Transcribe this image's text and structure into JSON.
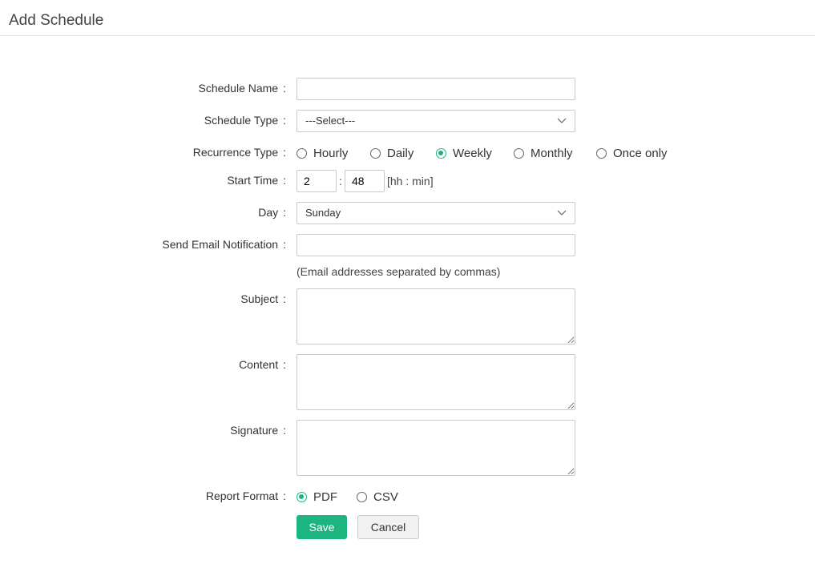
{
  "page": {
    "title": "Add Schedule"
  },
  "form": {
    "schedule_name": {
      "label": "Schedule Name",
      "value": ""
    },
    "schedule_type": {
      "label": "Schedule Type",
      "value": "---Select---"
    },
    "recurrence_type": {
      "label": "Recurrence Type",
      "options": [
        "Hourly",
        "Daily",
        "Weekly",
        "Monthly",
        "Once only"
      ],
      "selected": "Weekly"
    },
    "start_time": {
      "label": "Start Time",
      "hours": "2",
      "minutes": "48",
      "separator": ":",
      "hint": "[hh : min]"
    },
    "day": {
      "label": "Day",
      "value": "Sunday"
    },
    "email": {
      "label": "Send Email Notification",
      "value": "",
      "hint": "(Email addresses separated by commas)"
    },
    "subject": {
      "label": "Subject",
      "value": ""
    },
    "content": {
      "label": "Content",
      "value": ""
    },
    "signature": {
      "label": "Signature",
      "value": ""
    },
    "report_format": {
      "label": "Report Format",
      "options": [
        "PDF",
        "CSV"
      ],
      "selected": "PDF"
    },
    "colon": ":"
  },
  "actions": {
    "save_label": "Save",
    "cancel_label": "Cancel"
  },
  "colors": {
    "accent": "#1db57f",
    "border": "#c9c9c9"
  },
  "icons": {
    "select_chevron": "chevron-down-icon",
    "radio": "radio-icon"
  }
}
